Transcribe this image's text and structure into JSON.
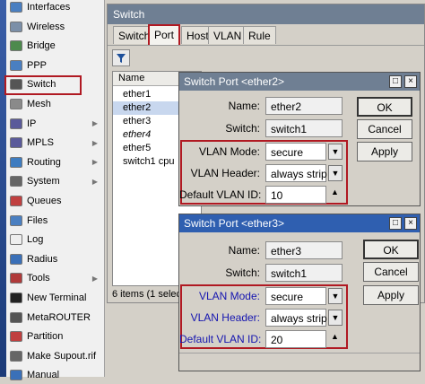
{
  "sidebar": {
    "items": [
      {
        "label": "Interfaces",
        "icon": "interfaces-icon",
        "color": "#4a7fc1",
        "submenu": false
      },
      {
        "label": "Wireless",
        "icon": "wireless-icon",
        "color": "#7b8fa8",
        "submenu": false
      },
      {
        "label": "Bridge",
        "icon": "bridge-icon",
        "color": "#4d8a4d",
        "submenu": false
      },
      {
        "label": "PPP",
        "icon": "ppp-icon",
        "color": "#4a7fc1",
        "submenu": false
      },
      {
        "label": "Switch",
        "icon": "switch-icon",
        "color": "#555555",
        "submenu": false
      },
      {
        "label": "Mesh",
        "icon": "mesh-icon",
        "color": "#8a8a8a",
        "submenu": false
      },
      {
        "label": "IP",
        "icon": "ip-icon",
        "color": "#5a5a9a",
        "submenu": true
      },
      {
        "label": "MPLS",
        "icon": "mpls-icon",
        "color": "#5a5a9a",
        "submenu": true
      },
      {
        "label": "Routing",
        "icon": "routing-icon",
        "color": "#3e7cc0",
        "submenu": true
      },
      {
        "label": "System",
        "icon": "system-icon",
        "color": "#666666",
        "submenu": true
      },
      {
        "label": "Queues",
        "icon": "queues-icon",
        "color": "#c04040",
        "submenu": false
      },
      {
        "label": "Files",
        "icon": "files-icon",
        "color": "#4a7fc1",
        "submenu": false
      },
      {
        "label": "Log",
        "icon": "log-icon",
        "color": "#eeeeee",
        "submenu": false
      },
      {
        "label": "Radius",
        "icon": "radius-icon",
        "color": "#3a70b8",
        "submenu": false
      },
      {
        "label": "Tools",
        "icon": "tools-icon",
        "color": "#b03a3a",
        "submenu": true
      },
      {
        "label": "New Terminal",
        "icon": "terminal-icon",
        "color": "#222222",
        "submenu": false
      },
      {
        "label": "MetaROUTER",
        "icon": "metarouter-icon",
        "color": "#555555",
        "submenu": false
      },
      {
        "label": "Partition",
        "icon": "partition-icon",
        "color": "#c04040",
        "submenu": false
      },
      {
        "label": "Make Supout.rif",
        "icon": "supout-icon",
        "color": "#666666",
        "submenu": false
      },
      {
        "label": "Manual",
        "icon": "manual-icon",
        "color": "#3a70b8",
        "submenu": false
      }
    ]
  },
  "switch_window": {
    "title": "Switch",
    "tabs": [
      "Switch",
      "Port",
      "Host",
      "VLAN",
      "Rule"
    ],
    "active_tab": "Port",
    "list_header": "Name",
    "rows": [
      "ether1",
      "ether2",
      "ether3",
      "ether4",
      "ether5",
      "switch1 cpu"
    ],
    "selected_row": "ether2",
    "italic_row": "ether4",
    "status": "6 items (1 selec"
  },
  "dialog1": {
    "title": "Switch Port <ether2>",
    "name_label": "Name:",
    "name_value": "ether2",
    "switch_label": "Switch:",
    "switch_value": "switch1",
    "vlan_mode_label": "VLAN Mode:",
    "vlan_mode_value": "secure",
    "vlan_header_label": "VLAN Header:",
    "vlan_header_value": "always strip",
    "default_vlan_label": "Default VLAN ID:",
    "default_vlan_value": "10",
    "ok": "OK",
    "cancel": "Cancel",
    "apply": "Apply"
  },
  "dialog2": {
    "title": "Switch Port <ether3>",
    "name_label": "Name:",
    "name_value": "ether3",
    "switch_label": "Switch:",
    "switch_value": "switch1",
    "vlan_mode_label": "VLAN Mode:",
    "vlan_mode_value": "secure",
    "vlan_header_label": "VLAN Header:",
    "vlan_header_value": "always strip",
    "default_vlan_label": "Default VLAN ID:",
    "default_vlan_value": "20",
    "ok": "OK",
    "cancel": "Cancel",
    "apply": "Apply"
  },
  "colors": {
    "highlight_red": "#b01922",
    "dialog1_title_bg": "#6f7f93",
    "dialog2_title_bg": "#2f5fb0",
    "label_blue": "#1515b0"
  }
}
